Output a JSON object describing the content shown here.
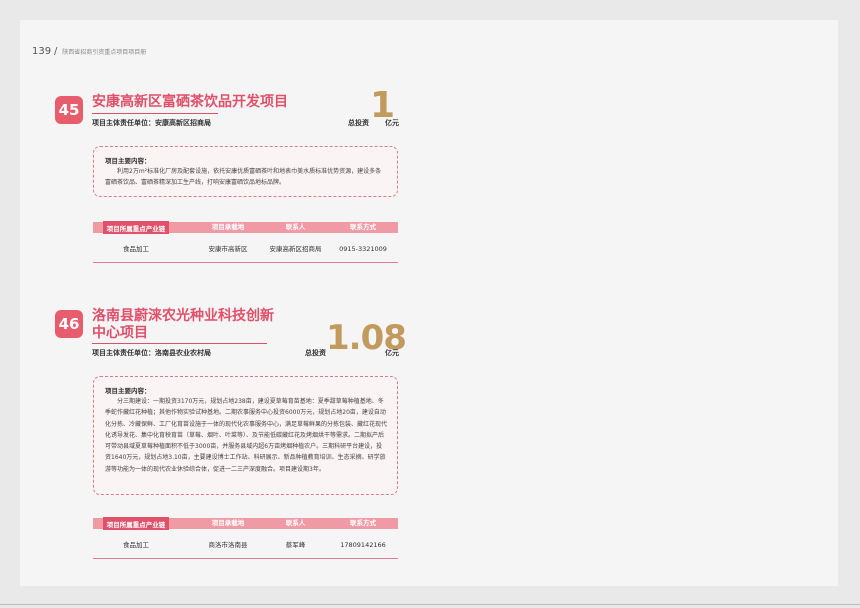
{
  "header": {
    "page_number": "139",
    "separator": "/",
    "subtitle": "陕西省招商引资重点项目项目册"
  },
  "projects": [
    {
      "number": "45",
      "title_line1": "安康高新区富硒茶饮品开发项目",
      "title_line2": "",
      "responsible_label": "项目主体责任单位：",
      "responsible_unit": "安康高新区招商局",
      "investment_label": "总投资",
      "investment_value": "1",
      "investment_unit": "亿元",
      "content_heading": "项目主要内容：",
      "content_text": "利用2万m²标准化厂房及配套设施，依托安康优质富硒茶叶和地表巾美水质标准优势资源，建设多条富硒茶饮品、富硒茶精深加工生产线，打响安康富硒饮品地标品牌。",
      "table_headers": [
        "项目所属重点产业链",
        "项目承载地",
        "联系人",
        "联系方式"
      ],
      "table_row": [
        "食品加工",
        "安康市高新区",
        "安康高新区招商局",
        "0915-3321009"
      ]
    },
    {
      "number": "46",
      "title_line1": "洛南县蔚涞农光种业科技创新",
      "title_line2": "中心项目",
      "responsible_label": "项目主体责任单位：",
      "responsible_unit": "洛南县农业农村局",
      "investment_label": "总投资",
      "investment_value": "1.08",
      "investment_unit": "亿元",
      "content_heading": "项目主要内容：",
      "content_text": "分三期建设：一期投资3170万元，规划占地238亩，建设夏草莓育苗基地：夏季甜草莓种植基地、冬季蛇作藏红花种植；其他作物实验试种基地。二期农事服务中心投资6000万元，规划占地20亩，建设自动化分拣、冷藏保鲜、工厂化育苗设施于一体的现代化农事服务中心，满足草莓鲜果的分拣包装、藏红花现代化诱导发花、集中化育秧育苗（草莓、烟叶、叶菜等）、及节能低碳藏红花及烤烟烘干等需求。二期拟产后可带动县域夏草莓种植面积不低于3000亩，并服务县域内超6万亩烤烟种植农户。三期科研平台建设，投资1640万元，规划占地3.10亩，主要建设博士工作站、科研展示、新品种植教育培训、生态采摘、研学旅游等功能为一体的现代农业休验综合体，促进一二三产深度融合。项目建设期3年。",
      "table_headers": [
        "项目所属重点产业链",
        "项目承载地",
        "联系人",
        "联系方式"
      ],
      "table_row": [
        "食品加工",
        "商洛市洛南县",
        "蔡军峰",
        "17809142166"
      ]
    }
  ]
}
